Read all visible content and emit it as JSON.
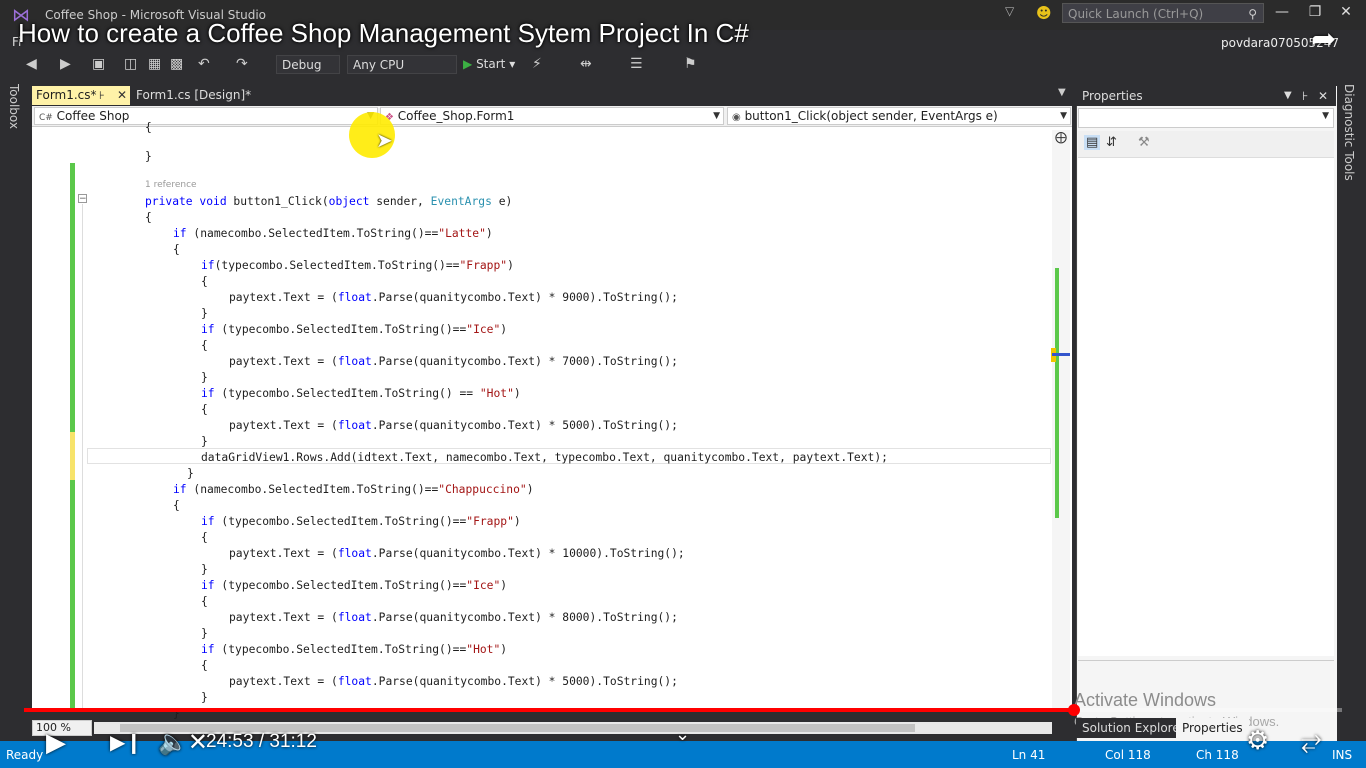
{
  "window": {
    "title": "Coffee Shop - Microsoft Visual Studio",
    "quick_launch_placeholder": "Quick Launch (Ctrl+Q)",
    "user": "povdara070505247",
    "menu_fragment": "Fi"
  },
  "video": {
    "title": "How to create a Coffee Shop Management Sytem Project In C#",
    "time": "24:53 / 31:12",
    "progress": 0.797
  },
  "toolbar": {
    "config": "Debug",
    "platform": "Any CPU",
    "start_label": "Start"
  },
  "side_labels": {
    "toolbox": "Toolbox",
    "diagnostic": "Diagnostic Tools"
  },
  "tabs": [
    {
      "label": "Form1.cs*",
      "active": true
    },
    {
      "label": "Form1.cs [Design]*",
      "active": false
    }
  ],
  "navbar": {
    "project": "Coffee Shop",
    "class": "Coffee_Shop.Form1",
    "member": "button1_Click(object sender, EventArgs e)"
  },
  "code": {
    "reference": "1 reference",
    "lines": [
      [
        {
          "t": "{"
        }
      ],
      [
        {
          "t": "}"
        }
      ],
      [],
      [
        {
          "t": "private void ",
          "c": "kw"
        },
        {
          "t": "button1_Click("
        },
        {
          "t": "object",
          "c": "kw"
        },
        {
          "t": " sender, "
        },
        {
          "t": "EventArgs",
          "c": "ty"
        },
        {
          "t": " e)"
        }
      ],
      [
        {
          "t": "{"
        }
      ],
      [
        {
          "t": "if",
          "c": "kw"
        },
        {
          "t": " (namecombo.SelectedItem.ToString()=="
        },
        {
          "t": "\"Latte\"",
          "c": "st"
        },
        {
          "t": ")"
        }
      ],
      [
        {
          "t": "{"
        }
      ],
      [
        {
          "t": "if",
          "c": "kw"
        },
        {
          "t": "(typecombo.SelectedItem.ToString()=="
        },
        {
          "t": "\"Frapp\"",
          "c": "st"
        },
        {
          "t": ")"
        }
      ],
      [
        {
          "t": "{"
        }
      ],
      [
        {
          "t": "paytext.Text = ("
        },
        {
          "t": "float",
          "c": "kw"
        },
        {
          "t": ".Parse(quanitycombo.Text) * 9000).ToString();"
        }
      ],
      [
        {
          "t": "}"
        }
      ],
      [
        {
          "t": "if",
          "c": "kw"
        },
        {
          "t": " (typecombo.SelectedItem.ToString()=="
        },
        {
          "t": "\"Ice\"",
          "c": "st"
        },
        {
          "t": ")"
        }
      ],
      [
        {
          "t": "{"
        }
      ],
      [
        {
          "t": "paytext.Text = ("
        },
        {
          "t": "float",
          "c": "kw"
        },
        {
          "t": ".Parse(quanitycombo.Text) * 7000).ToString();"
        }
      ],
      [
        {
          "t": "}"
        }
      ],
      [
        {
          "t": "if",
          "c": "kw"
        },
        {
          "t": " (typecombo.SelectedItem.ToString() == "
        },
        {
          "t": "\"Hot\"",
          "c": "st"
        },
        {
          "t": ")"
        }
      ],
      [
        {
          "t": "{"
        }
      ],
      [
        {
          "t": "paytext.Text = ("
        },
        {
          "t": "float",
          "c": "kw"
        },
        {
          "t": ".Parse(quanitycombo.Text) * 5000).ToString();"
        }
      ],
      [
        {
          "t": "}"
        }
      ],
      [
        {
          "t": "dataGridView1.Rows.Add(idtext.Text, namecombo.Text, typecombo.Text, quanitycombo.Text, paytext.Text);"
        }
      ],
      [
        {
          "t": "}"
        }
      ],
      [
        {
          "t": "if",
          "c": "kw"
        },
        {
          "t": " (namecombo.SelectedItem.ToString()=="
        },
        {
          "t": "\"Chappuccino\"",
          "c": "st"
        },
        {
          "t": ")"
        }
      ],
      [
        {
          "t": "{"
        }
      ],
      [
        {
          "t": "if",
          "c": "kw"
        },
        {
          "t": " (typecombo.SelectedItem.ToString()=="
        },
        {
          "t": "\"Frapp\"",
          "c": "st"
        },
        {
          "t": ")"
        }
      ],
      [
        {
          "t": "{"
        }
      ],
      [
        {
          "t": "paytext.Text = ("
        },
        {
          "t": "float",
          "c": "kw"
        },
        {
          "t": ".Parse(quanitycombo.Text) * 10000).ToString();"
        }
      ],
      [
        {
          "t": "}"
        }
      ],
      [
        {
          "t": "if",
          "c": "kw"
        },
        {
          "t": " (typecombo.SelectedItem.ToString()=="
        },
        {
          "t": "\"Ice\"",
          "c": "st"
        },
        {
          "t": ")"
        }
      ],
      [
        {
          "t": "{"
        }
      ],
      [
        {
          "t": "paytext.Text = ("
        },
        {
          "t": "float",
          "c": "kw"
        },
        {
          "t": ".Parse(quanitycombo.Text) * 8000).ToString();"
        }
      ],
      [
        {
          "t": "}"
        }
      ],
      [
        {
          "t": "if",
          "c": "kw"
        },
        {
          "t": " (typecombo.SelectedItem.ToString()=="
        },
        {
          "t": "\"Hot\"",
          "c": "st"
        },
        {
          "t": ")"
        }
      ],
      [
        {
          "t": "{"
        }
      ],
      [
        {
          "t": "paytext.Text = ("
        },
        {
          "t": "float",
          "c": "kw"
        },
        {
          "t": ".Parse(quanitycombo.Text) * 5000).ToString();"
        }
      ],
      [
        {
          "t": "}"
        }
      ],
      [
        {
          "t": "}"
        }
      ]
    ]
  },
  "properties": {
    "header": "Properties"
  },
  "activate": {
    "line1": "Activate Windows",
    "line2": "Go to Settings to activate Windows."
  },
  "bottom_tabs": {
    "solution_explorer": "Solution Explorer",
    "properties": "Properties"
  },
  "zoom": "100 %",
  "status": {
    "ready": "Ready",
    "ln": "Ln 41",
    "col": "Col 118",
    "ch": "Ch 118",
    "ins": "INS"
  },
  "colors": {
    "keyword": "#0000ff",
    "type": "#2b91af",
    "string": "#a31515",
    "status_bar": "#007acc",
    "progress": "#ff0000"
  }
}
